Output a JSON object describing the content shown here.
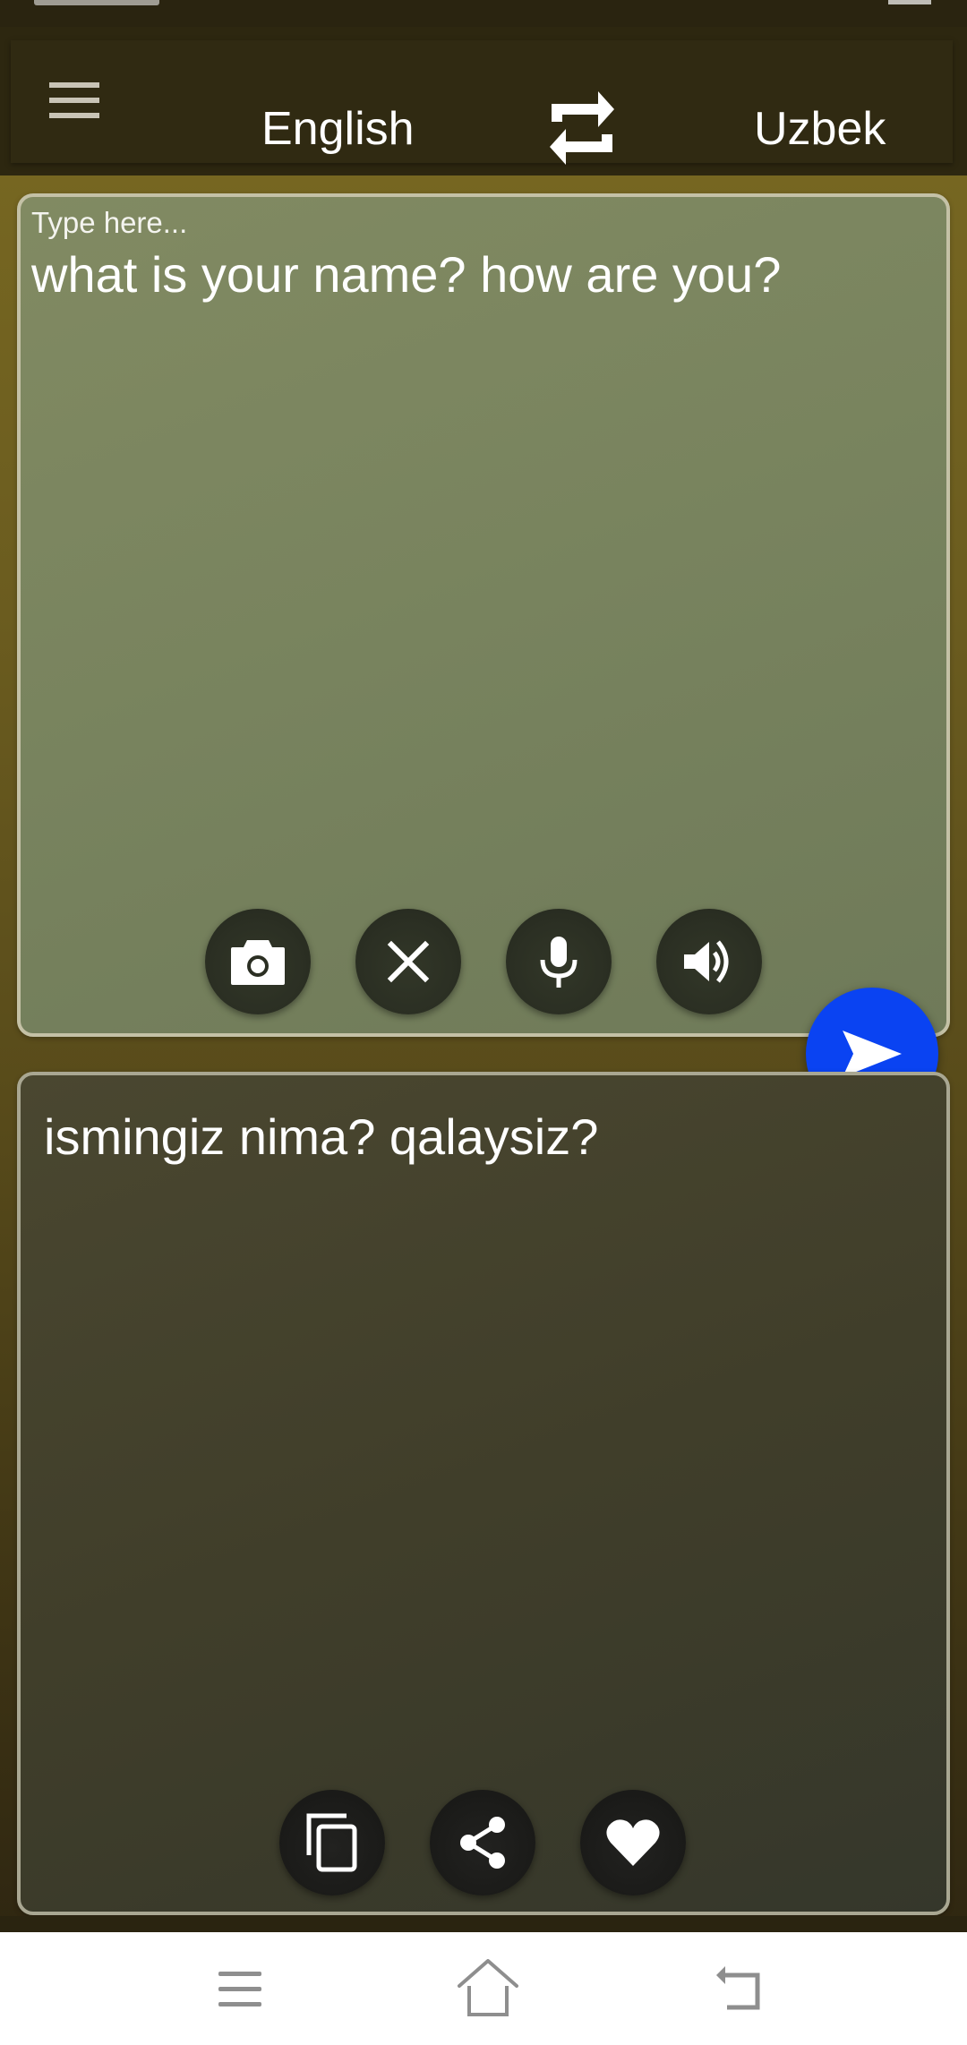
{
  "app_bar": {
    "menu_icon": "hamburger-menu-icon",
    "source_language": "English",
    "swap_icon": "swap-languages-icon",
    "target_language": "Uzbek"
  },
  "input_panel": {
    "placeholder": "Type here...",
    "value": "what is your name? how are you?",
    "actions": [
      {
        "name": "camera",
        "icon": "camera-icon"
      },
      {
        "name": "clear",
        "icon": "close-icon"
      },
      {
        "name": "voice-input",
        "icon": "microphone-icon"
      },
      {
        "name": "speak",
        "icon": "speaker-icon"
      }
    ]
  },
  "send_button": {
    "icon": "send-icon",
    "color": "#0a43f2"
  },
  "output_panel": {
    "text": "ismingiz nima? qalaysiz?",
    "actions": [
      {
        "name": "copy",
        "icon": "copy-icon"
      },
      {
        "name": "share",
        "icon": "share-icon"
      },
      {
        "name": "favorite",
        "icon": "heart-icon"
      }
    ]
  },
  "navigation_bar": {
    "buttons": [
      {
        "name": "recents",
        "icon": "recents-icon"
      },
      {
        "name": "home",
        "icon": "home-icon"
      },
      {
        "name": "back",
        "icon": "back-icon"
      }
    ]
  }
}
